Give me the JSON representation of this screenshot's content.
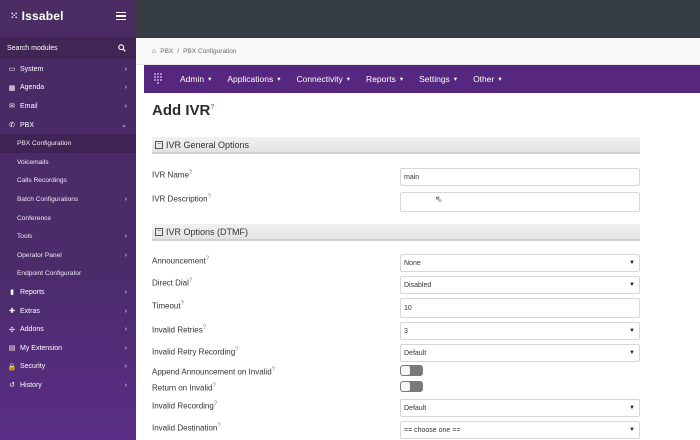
{
  "brand": {
    "name": "Issabel"
  },
  "sidebar": {
    "search_label": "Search modules",
    "items": [
      {
        "label": "System",
        "icon": "monitor-icon",
        "glyph": "▭",
        "chevron": "›",
        "type": "top"
      },
      {
        "label": "Agenda",
        "icon": "calendar-icon",
        "glyph": "▦",
        "chevron": "›",
        "type": "top"
      },
      {
        "label": "Email",
        "icon": "envelope-icon",
        "glyph": "✉",
        "chevron": "›",
        "type": "top"
      },
      {
        "label": "PBX",
        "icon": "phone-icon",
        "glyph": "✆",
        "chevron": "⌄",
        "type": "top"
      },
      {
        "label": "PBX Configuration",
        "type": "sub",
        "active": true
      },
      {
        "label": "Voicemails",
        "type": "sub"
      },
      {
        "label": "Calls Recordings",
        "type": "sub"
      },
      {
        "label": "Batch Configurations",
        "chevron": "›",
        "type": "sub"
      },
      {
        "label": "Conference",
        "type": "sub"
      },
      {
        "label": "Tools",
        "chevron": "›",
        "type": "sub"
      },
      {
        "label": "Operator Panel",
        "chevron": "›",
        "type": "sub"
      },
      {
        "label": "Endpoint Configurator",
        "type": "sub"
      },
      {
        "label": "Reports",
        "icon": "bar-chart-icon",
        "glyph": "▮",
        "chevron": "›",
        "type": "top"
      },
      {
        "label": "Extras",
        "icon": "plus-icon",
        "glyph": "✚",
        "chevron": "›",
        "type": "top"
      },
      {
        "label": "Addons",
        "icon": "puzzle-icon",
        "glyph": "✣",
        "chevron": "›",
        "type": "top"
      },
      {
        "label": "My Extension",
        "icon": "id-card-icon",
        "glyph": "▤",
        "chevron": "›",
        "type": "top"
      },
      {
        "label": "Security",
        "icon": "lock-icon",
        "glyph": "🔒",
        "chevron": "›",
        "type": "top"
      },
      {
        "label": "History",
        "icon": "history-icon",
        "glyph": "↺",
        "chevron": "›",
        "type": "top"
      }
    ]
  },
  "breadcrumb": {
    "home": "PBX",
    "separator": "/",
    "current": "PBX Configuration"
  },
  "navbar": {
    "items": [
      {
        "label": "Admin",
        "caret": "▾"
      },
      {
        "label": "Applications",
        "caret": "▾"
      },
      {
        "label": "Connectivity",
        "caret": "▾"
      },
      {
        "label": "Reports",
        "caret": "▾"
      },
      {
        "label": "Settings",
        "caret": "▾"
      },
      {
        "label": "Other",
        "caret": "▾"
      }
    ]
  },
  "page": {
    "title": "Add IVR",
    "help_glyph": "?",
    "section1": {
      "title": "IVR General Options",
      "collapse": "−"
    },
    "section2": {
      "title": "IVR Options (DTMF)",
      "collapse": "−"
    },
    "fields": {
      "ivr_name": {
        "label": "IVR Name",
        "value": "main"
      },
      "ivr_description": {
        "label": "IVR Description",
        "value": ""
      },
      "announcement": {
        "label": "Announcement",
        "value": "None"
      },
      "direct_dial": {
        "label": "Direct Dial",
        "value": "Disabled"
      },
      "timeout": {
        "label": "Timeout",
        "value": "10"
      },
      "invalid_retries": {
        "label": "Invalid Retries",
        "value": "3"
      },
      "invalid_retry_recording": {
        "label": "Invalid Retry Recording",
        "value": "Default"
      },
      "append_announcement": {
        "label": "Append Announcement on Invalid"
      },
      "return_on_invalid": {
        "label": "Return on Invalid"
      },
      "invalid_recording": {
        "label": "Invalid Recording",
        "value": "Default"
      },
      "invalid_destination": {
        "label": "Invalid Destination",
        "value": "== choose one =="
      }
    },
    "select_arrow": "▼"
  },
  "colors": {
    "sidebar": "#4b2b6a",
    "navbar": "#55277f",
    "topbar": "#363d45",
    "accent_help": "#8a7fb0"
  }
}
